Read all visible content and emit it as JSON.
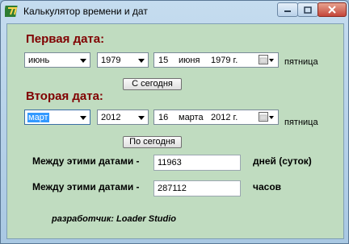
{
  "window": {
    "title": "Калькулятор времени и дат"
  },
  "first": {
    "heading": "Первая дата:",
    "month": "июнь",
    "year": "1979",
    "date_day": "15",
    "date_month": "июня",
    "date_year": "1979 г.",
    "weekday": "пятница",
    "today_button": "С сегодня"
  },
  "second": {
    "heading": "Вторая дата:",
    "month": "март",
    "year": "2012",
    "date_day": "16",
    "date_month": "марта",
    "date_year": "2012 г.",
    "weekday": "пятница",
    "today_button": "По сегодня"
  },
  "results": {
    "days_label": "Между этими датами -",
    "days_value": "11963",
    "days_unit": "дней (суток)",
    "hours_label": "Между этими датами -",
    "hours_value": "287112",
    "hours_unit": "часов"
  },
  "developer": "разработчик: Loader Studio",
  "colors": {
    "heading": "#800000",
    "background": "#c0dcc0",
    "selection": "#3399ff"
  }
}
